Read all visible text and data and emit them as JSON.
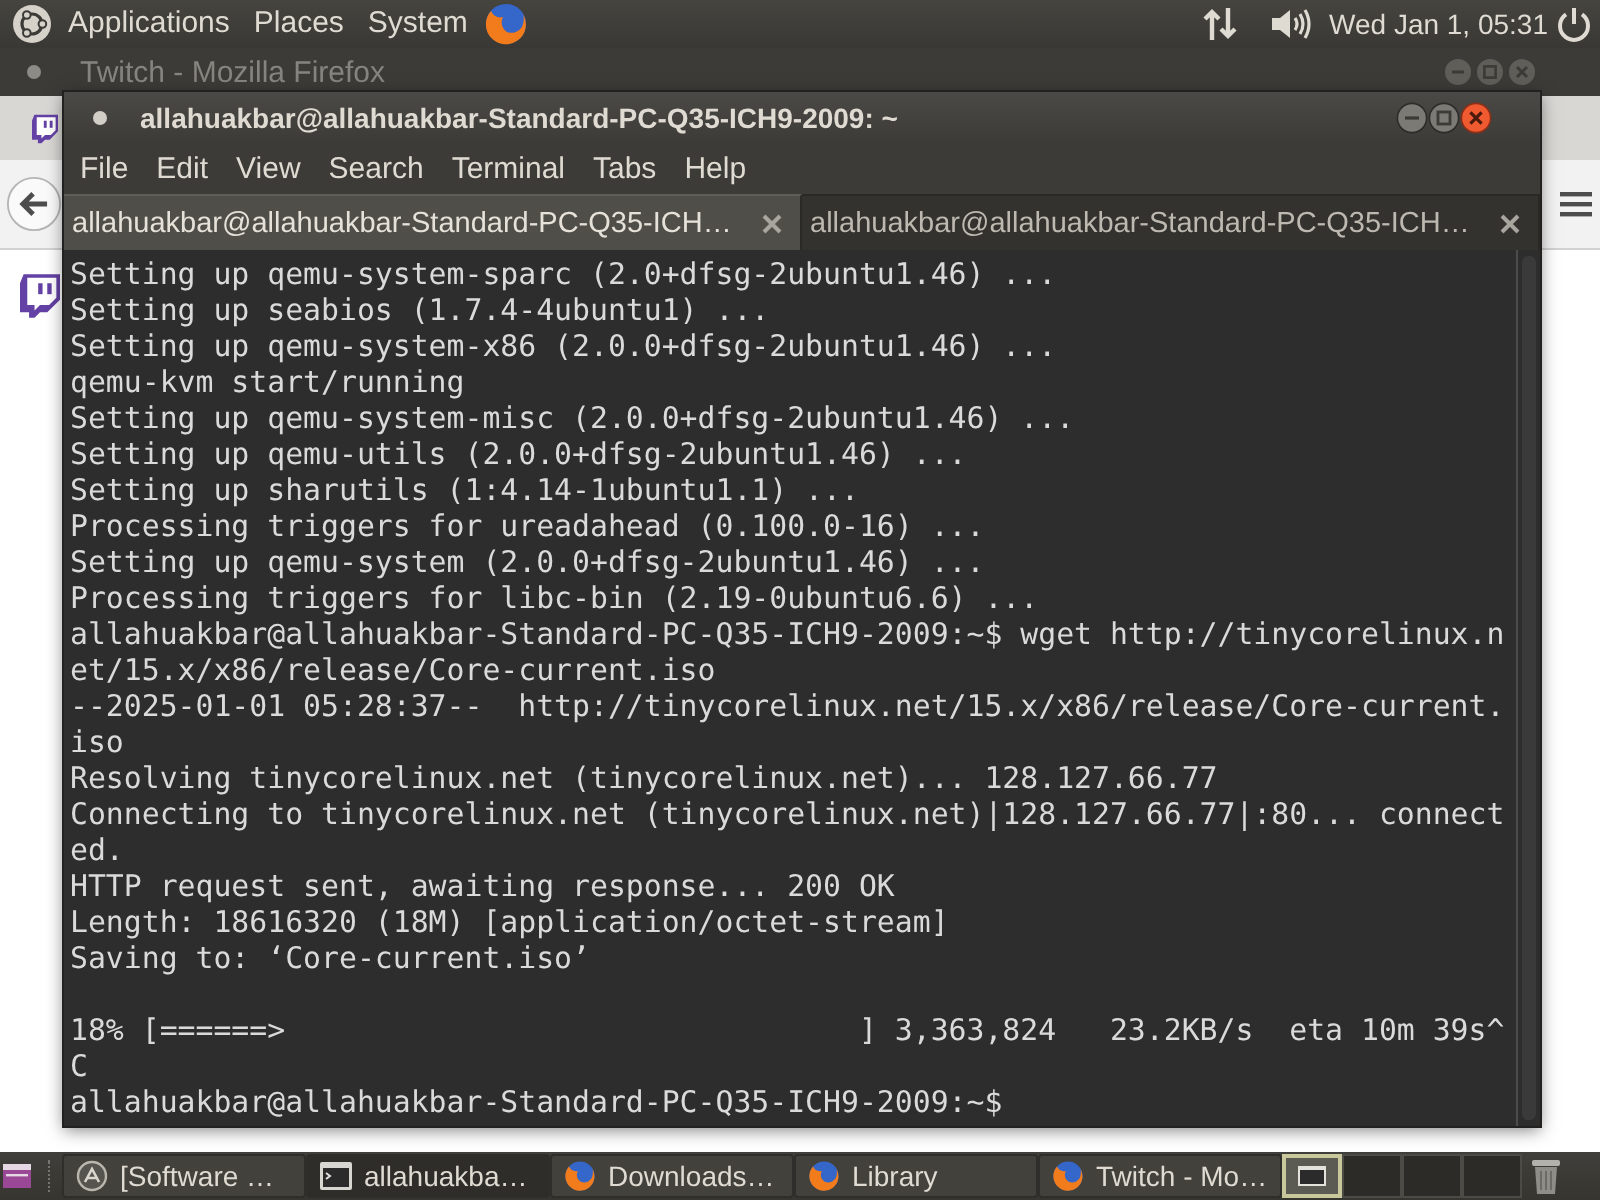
{
  "top_panel": {
    "menus": [
      "Applications",
      "Places",
      "System"
    ],
    "clock": "Wed Jan 1, 05:31"
  },
  "browser_window": {
    "title": "Twitch - Mozilla Firefox"
  },
  "terminal": {
    "title": "allahuakbar@allahuakbar-Standard-PC-Q35-ICH9-2009: ~",
    "menu": [
      "File",
      "Edit",
      "View",
      "Search",
      "Terminal",
      "Tabs",
      "Help"
    ],
    "tabs": [
      {
        "label": "allahuakbar@allahuakbar-Standard-PC-Q35-ICH…",
        "selected": true
      },
      {
        "label": "allahuakbar@allahuakbar-Standard-PC-Q35-ICH…",
        "selected": false
      }
    ],
    "blocks": [
      {
        "lines": [
          "Setting up qemu-system-sparc (2.0+dfsg-2ubuntu1.46) ...",
          "Setting up seabios (1.7.4-4ubuntu1) ...",
          "Setting up qemu-system-x86 (2.0.0+dfsg-2ubuntu1.46) ...",
          "qemu-kvm start/running",
          "Setting up qemu-system-misc (2.0.0+dfsg-2ubuntu1.46) ...",
          "Setting up qemu-utils (2.0.0+dfsg-2ubuntu1.46) ...",
          "Setting up sharutils (1:4.14-1ubuntu1.1) ...",
          "Processing triggers for ureadahead (0.100.0-16) ...",
          "Setting up qemu-system (2.0.0+dfsg-2ubuntu1.46) ...",
          "Processing triggers for libc-bin (2.19-0ubuntu6.6) ...",
          "allahuakbar@allahuakbar-Standard-PC-Q35-ICH9-2009:~$ wget http://tinycorelinux.n",
          "et/15.x/x86/release/Core-current.iso",
          "--2025-01-01 05:28:37--  http://tinycorelinux.net/15.x/x86/release/Core-current.",
          "iso",
          "Resolving tinycorelinux.net (tinycorelinux.net)... 128.127.66.77",
          "Connecting to tinycorelinux.net (tinycorelinux.net)|128.127.66.77|:80... connect",
          "ed.",
          "HTTP request sent, awaiting response... 200 OK",
          "Length: 18616320 (18M) [application/octet-stream]",
          "Saving to: ‘Core-current.iso’"
        ]
      },
      {
        "lines": [
          "18% [======>                                ] 3,363,824   23.2KB/s  eta 10m 39s^",
          "C",
          "allahuakbar@allahuakbar-Standard-PC-Q35-ICH9-2009:~$"
        ]
      }
    ]
  },
  "taskbar": {
    "items": [
      {
        "label": "[Software …",
        "kind": "updater",
        "selected": false
      },
      {
        "label": "allahuakba…",
        "kind": "terminal",
        "selected": true
      },
      {
        "label": "Downloads…",
        "kind": "browser",
        "selected": false
      },
      {
        "label": "Library",
        "kind": "browser",
        "selected": false
      },
      {
        "label": "Twitch - Mo…",
        "kind": "browser",
        "selected": false
      }
    ],
    "workspaces": [
      {
        "selected": true,
        "has_window": true
      },
      {
        "selected": false,
        "has_window": false
      },
      {
        "selected": false,
        "has_window": false
      },
      {
        "selected": false,
        "has_window": false
      }
    ]
  }
}
